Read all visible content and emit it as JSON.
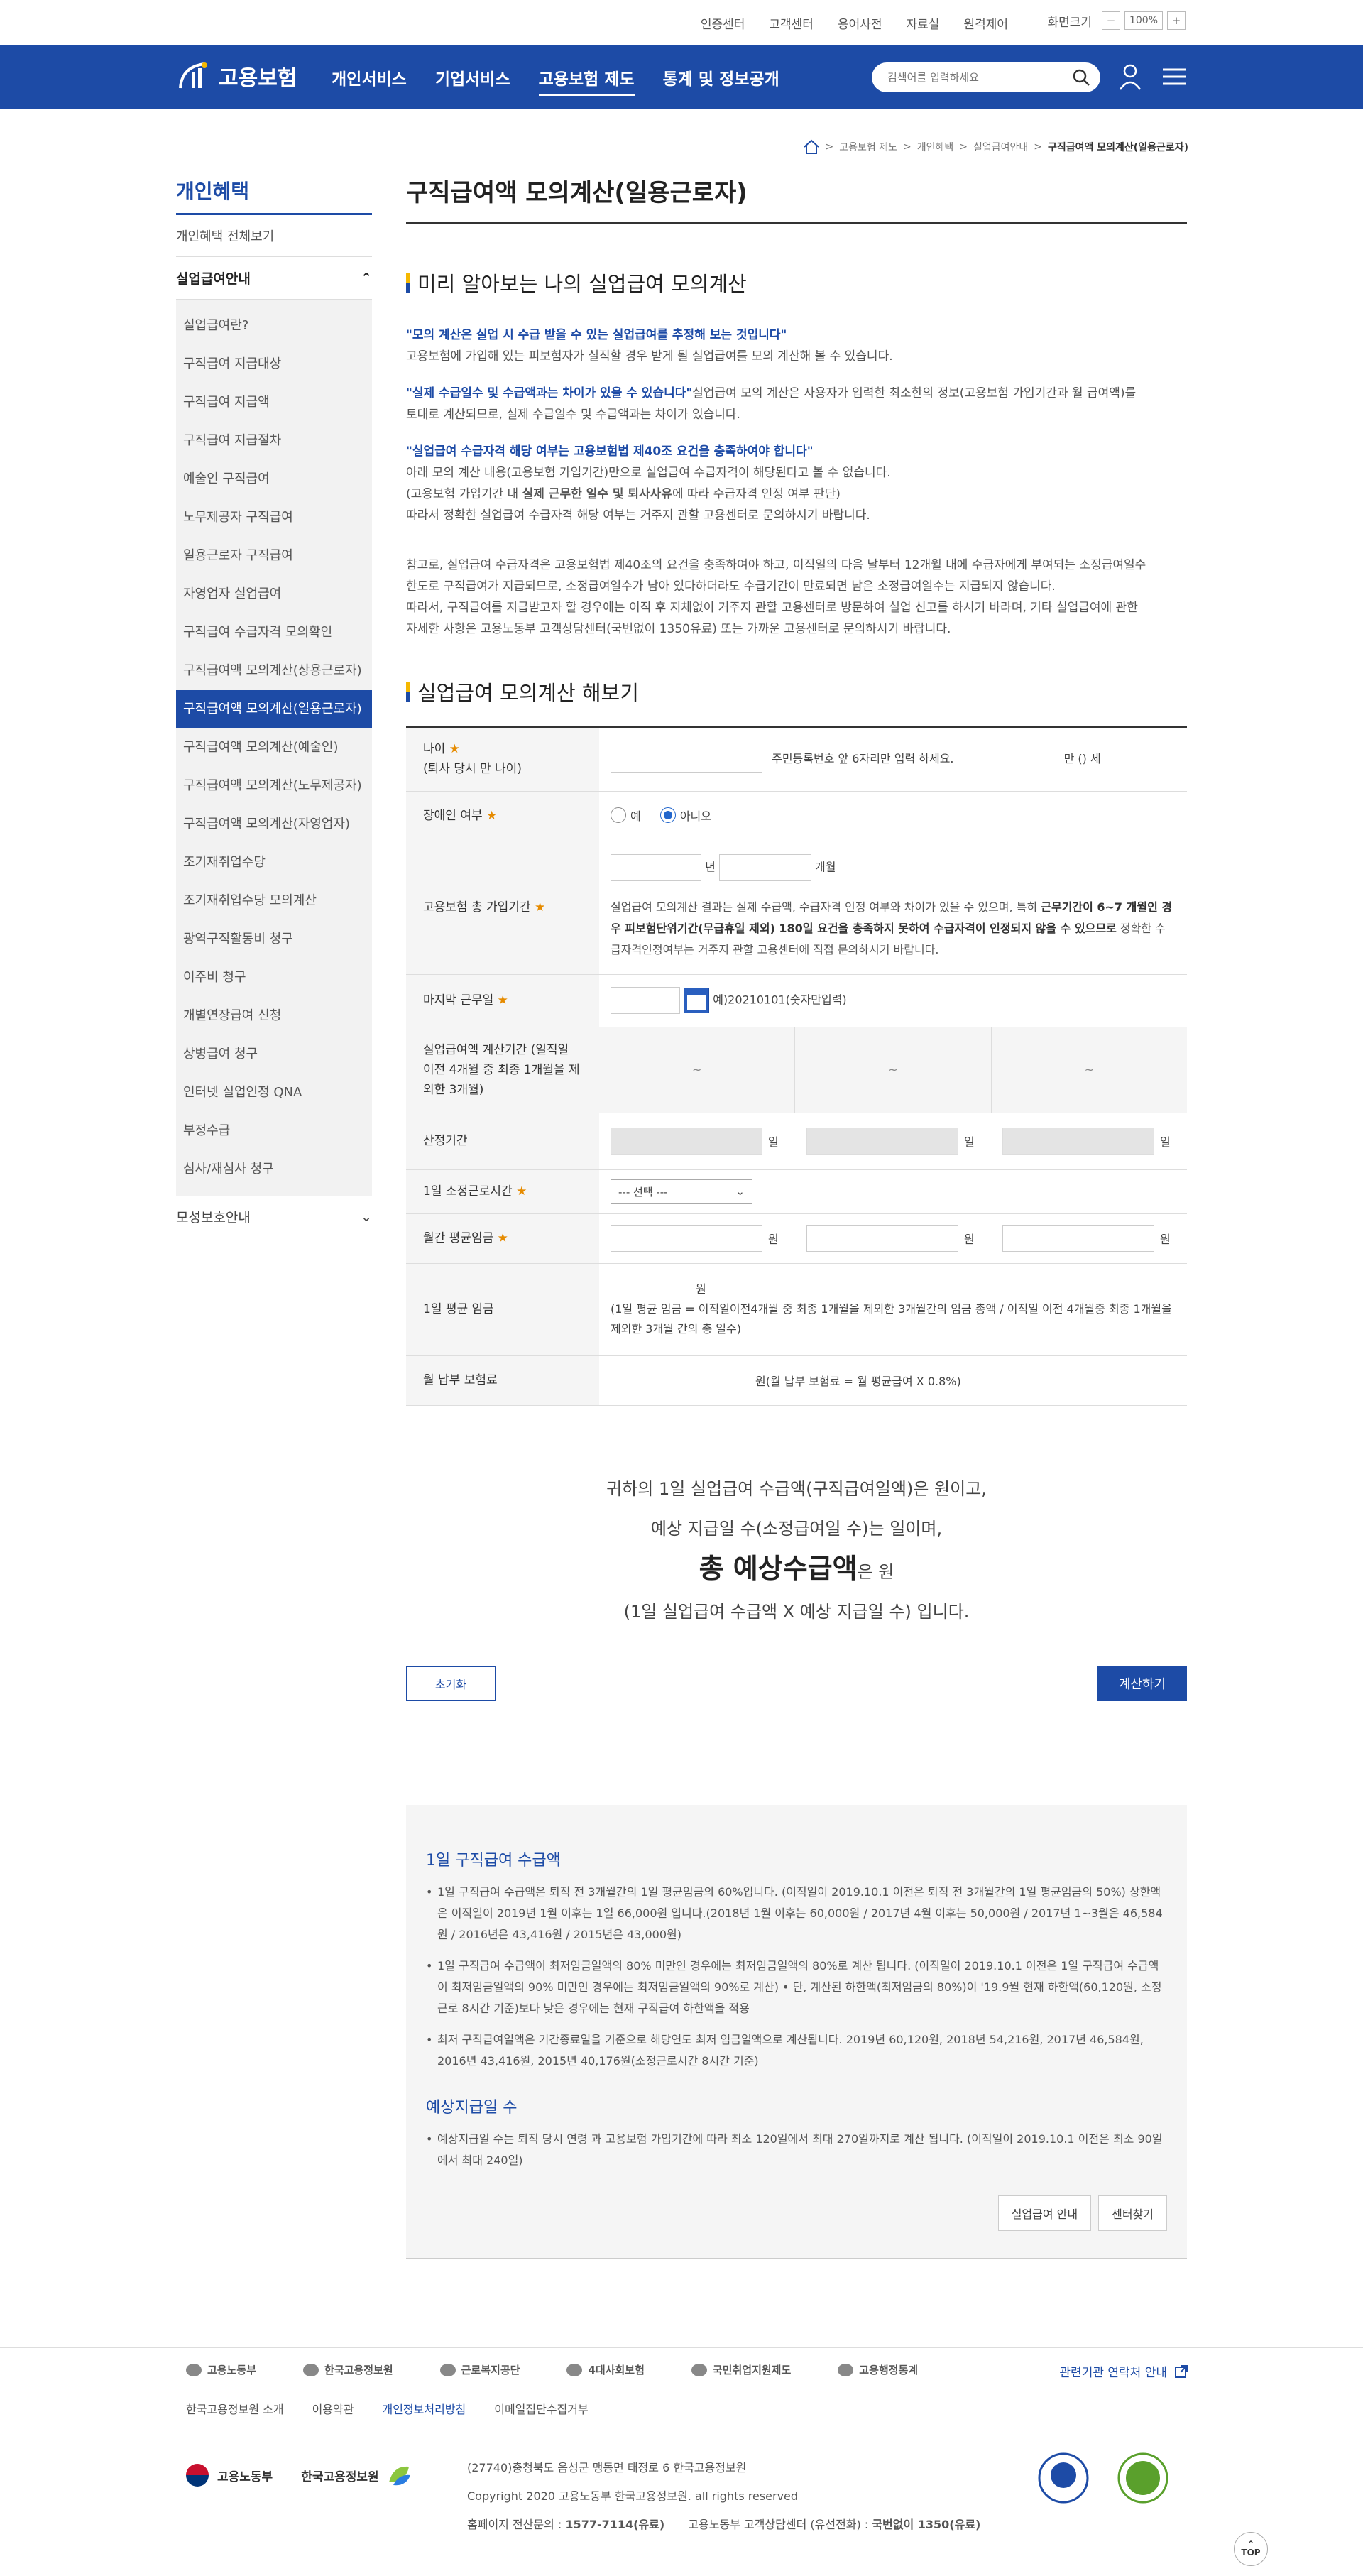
{
  "util": {
    "links": [
      "인증센터",
      "고객센터",
      "용어사전",
      "자료실",
      "원격제어"
    ],
    "zoom_label": "화면크기",
    "zoom_minus": "−",
    "zoom_value": "100%",
    "zoom_plus": "+"
  },
  "header": {
    "logo_text": "고용보험",
    "nav": [
      "개인서비스",
      "기업서비스",
      "고용보험 제도",
      "통계 및 정보공개"
    ],
    "search_placeholder": "검색어를 입력하세요",
    "accent": "#1d4ba6"
  },
  "breadcrumb": [
    "고용보험 제도",
    "개인혜택",
    "실업급여안내",
    "구직급여액 모의계산(일용근로자)"
  ],
  "sidebar": {
    "title": "개인혜택",
    "all_link": "개인혜택 전체보기",
    "group": "실업급여안내",
    "items": [
      "실업급여란?",
      "구직급여 지급대상",
      "구직급여 지급액",
      "구직급여 지급절차",
      "예술인 구직급여",
      "노무제공자 구직급여",
      "일용근로자 구직급여",
      "자영업자 실업급여",
      "구직급여 수급자격 모의확인",
      "구직급여액 모의계산(상용근로자)",
      "구직급여액 모의계산(일용근로자)",
      "구직급여액 모의계산(예술인)",
      "구직급여액 모의계산(노무제공자)",
      "구직급여액 모의계산(자영업자)",
      "조기재취업수당",
      "조기재취업수당 모의계산",
      "광역구직활동비 청구",
      "이주비 청구",
      "개별연장급여 신청",
      "상병급여 청구",
      "인터넷 실업인정 QNA",
      "부정수급",
      "심사/재심사 청구"
    ],
    "group2": "모성보호안내"
  },
  "main": {
    "title": "구직급여액 모의계산(일용근로자)",
    "section1": "미리 알아보는 나의 실업급여 모의계산",
    "note1_em": "\"모의 계산은 실업 시 수급 받을 수 있는 실업급여를 추정해 보는 것입니다\"",
    "note1": "고용보험에 가입해 있는 피보험자가 실직할 경우 받게 될 실업급여를 모의 계산해 볼 수 있습니다.",
    "note2_em": "\"실제 수급일수 및 수급액과는 차이가 있을 수 있습니다\"",
    "note2a": "실업급여 모의 계산은 사용자가 입력한 최소한의 정보(고용보험 가입기간과 월 급여액)를",
    "note2b": "토대로 계산되므로, 실제 수급일수 및 수급액과는 차이가 있습니다.",
    "note3_em": "\"실업급여 수급자격 해당 여부는 고용보험법 제40조 요건을 충족하여야 합니다\"",
    "note3a": "아래 모의 계산 내용(고용보험 가입기간)만으로 실업급여 수급자격이 해당된다고 볼 수 없습니다.",
    "note3b_pre": "(고용보험 가입기간 내 ",
    "note3b_bold": "실제 근무한 일수 및 퇴사사유",
    "note3b_post": "에 따라 수급자격 인정 여부 판단)",
    "note3c": "따라서 정확한 실업급여 수급자격 해당 여부는 거주지 관할 고용센터로 문의하시기 바랍니다.",
    "note4a": "참고로, 실업급여 수급자격은 고용보험법 제40조의 요건을 충족하여야 하고, 이직일의 다음 날부터 12개월 내에 수급자에게 부여되는 소정급여일수",
    "note4b": "한도로 구직급여가 지급되므로, 소정급여일수가 남아 있다하더라도 수급기간이 만료되면 남은 소정급여일수는 지급되지 않습니다.",
    "note4c": "따라서, 구직급여를 지급받고자 할 경우에는 이직 후 지체없이 거주지 관할 고용센터로 방문하여 실업 신고를 하시기 바라며, 기타 실업급여에 관한",
    "note4d": "자세한 사항은 고용노동부 고객상담센터(국번없이 1350유료) 또는 가까운 고용센터로 문의하시기 바랍니다.",
    "section2": "실업급여 모의계산 해보기"
  },
  "form": {
    "age_label": "나이",
    "age_sub": "(퇴사 당시 만 나이)",
    "age_hint": "주민등록번호 앞 6자리만 입력 하세요.",
    "age_result": "만 () 세",
    "disabled_label": "장애인 여부",
    "yes": "예",
    "no": "아니오",
    "period_label": "고용보험 총 가입기간",
    "year": "년",
    "month": "개월",
    "period_note_a": "실업급여 모의계산 결과는 실제 수급액, 수급자격 인정 여부와 차이가 있을 수 있으며, 특히 ",
    "period_note_bold": "근무기간이 6~7 개월인 경우 피보험단위기간(무급휴일 제외) 180일 요건을 충족하지 못하여 수급자격이 인정되지 않을 수 있으므로",
    "period_note_b": " 정확한 수급자격인정여부는 거주지 관할 고용센터에 직접 문의하시기 바랍니다.",
    "lastday_label": "마지막 근무일",
    "lastday_hint": "예)20210101(숫자만입력)",
    "calc_period_label": "실업급여액 계산기간 (일직일 이전 4개월 중 최종 1개월을 제외한 3개월)",
    "tilde": "~",
    "days_label": "산정기간",
    "day_unit": "일",
    "hours_label": "1일 소정근로시간",
    "hours_select": "--- 선택 ---",
    "wage_label": "월간 평균임금",
    "won": "원",
    "daily_label": "1일 평균 임금",
    "daily_won": "원",
    "daily_note": "(1일 평균 임금 = 이직일이전4개월 중 최종 1개월을 제외한 3개월간의 임금 총액 / 이직일 이전 4개월중 최종 1개월을 제외한 3개월 간의 총 일수)",
    "premium_label": "월 납부 보험료",
    "premium_note": "원(월 납부 보험료 = 월 평균급여 X 0.8%)"
  },
  "result": {
    "line1": "귀하의 1일 실업급여 수급액(구직급여일액)은 원이고,",
    "line2": "예상 지급일 수(소정급여일 수)는 일이며,",
    "line3_big": "총 예상수급액",
    "line3_rest": "은 원",
    "line4": "(1일 실업급여 수급액 X 예상 지급일 수) 입니다.",
    "reset": "초기화",
    "calc": "계산하기"
  },
  "info": {
    "h1": "1일 구직급여 수급액",
    "b1": "1일 구직급여 수급액은 퇴직 전 3개월간의 1일 평균임금의 60%입니다. (이직일이 2019.10.1 이전은 퇴직 전 3개월간의 1일 평균임금의 50%) 상한액은 이직일이 2019년 1월 이후는 1일 66,000원 입니다.(2018년 1월 이후는 60,000원 / 2017년 4월 이후는 50,000원 / 2017년 1~3월은 46,584원 / 2016년은 43,416원 / 2015년은 43,000원)",
    "b2": "1일 구직급여 수급액이 최저임금일액의 80% 미만인 경우에는 최저임금일액의 80%로 계산 됩니다. (이직일이 2019.10.1 이전은 1일 구직급여 수급액이 최저임금일액의 90% 미만인 경우에는 최저임금일액의 90%로 계산) • 단, 계산된 하한액(최저임금의 80%)이 '19.9월 현재 하한액(60,120원, 소정근로 8시간 기준)보다 낮은 경우에는 현재 구직급여 하한액을 적용",
    "b3": "최저 구직급여일액은 기간종료일을 기준으로 해당연도 최저 임금일액으로 계산됩니다. 2019년 60,120원, 2018년 54,216원, 2017년 46,584원, 2016년 43,416원, 2015년 40,176원(소정근로시간 8시간 기준)",
    "h2": "예상지급일 수",
    "b4": "예상지급일 수는 퇴직 당시 연령 과 고용보험 가입기간에 따라 최소 120일에서 최대 270일까지로 계산 됩니다. (이직일이 2019.10.1 이전은 최소 90일에서 최대 240일)",
    "btn1": "실업급여 안내",
    "btn2": "센터찾기"
  },
  "footer": {
    "orgs": [
      "고용노동부",
      "한국고용정보원",
      "근로복지공단",
      "4대사회보험",
      "국민취업지원제도",
      "고용행정통계"
    ],
    "org_link": "관련기관 연락처 안내",
    "links": [
      "한국고용정보원 소개",
      "이용약관",
      "개인정보처리방침",
      "이메일집단수집거부"
    ],
    "logo1": "고용노동부",
    "logo2": "한국고용정보원",
    "address": "(27740)충청북도 음성군 맹동면 태정로 6 한국고용정보원",
    "copyright": "Copyright 2020 고용노동부 한국고용정보원. all rights reserved",
    "contact_pre": "홈페이지 전산문의 : ",
    "contact_num": "1577-7114(유료)",
    "contact_mid": "고용노동부 고객상담센터 (유선전화) : ",
    "contact_num2": "국번없이 1350(유료)",
    "top": "TOP"
  }
}
